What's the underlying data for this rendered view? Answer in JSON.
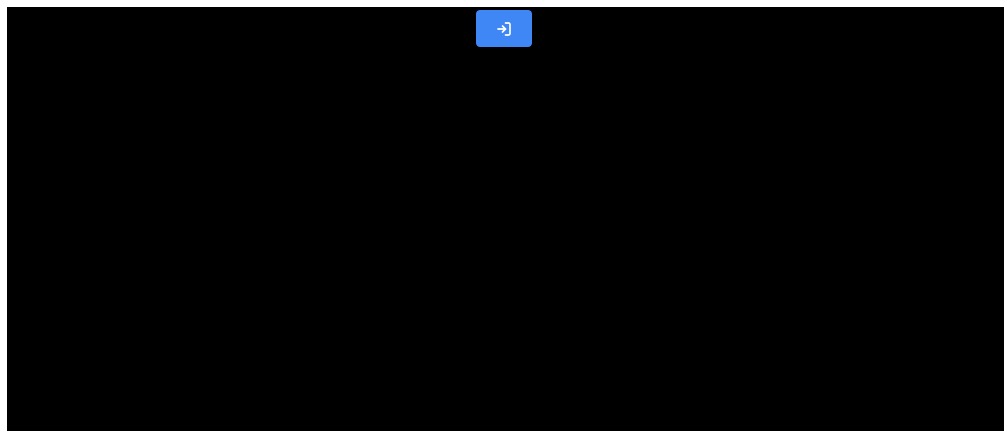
{
  "colors": {
    "page_background": "#ffffff",
    "viewport_background": "#000000",
    "button_background": "#3f87f5",
    "button_icon": "#ffffff"
  },
  "enter_button": {
    "icon": "sign-in-icon"
  }
}
